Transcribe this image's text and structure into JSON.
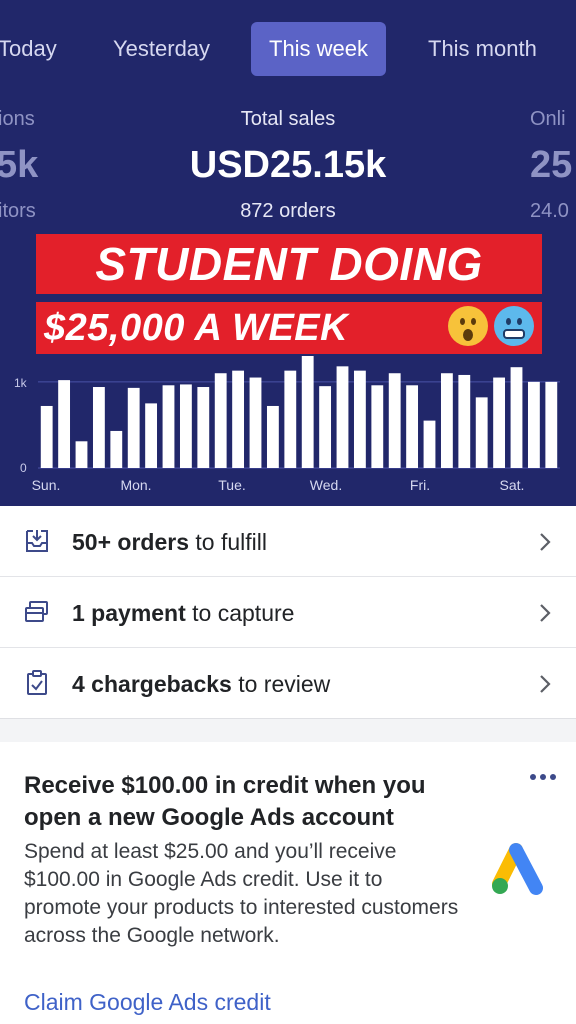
{
  "tabs": [
    {
      "label": "Today"
    },
    {
      "label": "Yesterday"
    },
    {
      "label": "This week",
      "active": true
    },
    {
      "label": "This month"
    }
  ],
  "stats": {
    "left": {
      "label": "ions",
      "value": "5k",
      "sub": "itors"
    },
    "center": {
      "label": "Total sales",
      "value": "USD25.15k",
      "sub": "872 orders"
    },
    "right": {
      "label": "Onli",
      "value": "25",
      "sub": "24.0"
    }
  },
  "overlay": {
    "line1": "STUDENT DOING",
    "line2": "$25,000 A WEEK",
    "emojis": [
      "astonished-face",
      "cold-face"
    ]
  },
  "chart_data": {
    "type": "bar",
    "ylabel_ticks": [
      "0",
      "1k"
    ],
    "ylim": [
      0,
      1300
    ],
    "grid": true,
    "day_labels": [
      "Sun.",
      "Mon.",
      "Tue.",
      "Wed.",
      "Fri.",
      "Sat."
    ],
    "values": [
      720,
      1020,
      310,
      940,
      430,
      930,
      750,
      960,
      970,
      940,
      1100,
      1130,
      1050,
      720,
      1130,
      1380,
      950,
      1180,
      1130,
      960,
      1100,
      960,
      550,
      1100,
      1080,
      820,
      1050,
      1170,
      1000,
      1000
    ]
  },
  "tasks": [
    {
      "bold": "50+ orders",
      "rest": " to fulfill",
      "icon": "inbox-download-icon"
    },
    {
      "bold": "1 payment",
      "rest": " to capture",
      "icon": "payment-card-icon"
    },
    {
      "bold": "4 chargebacks",
      "rest": " to review",
      "icon": "clipboard-check-icon"
    }
  ],
  "card": {
    "title": "Receive $100.00 in credit when you open a new Google Ads account",
    "body": "Spend at least $25.00 and you’ll receive $100.00 in Google Ads credit. Use it to promote your products to interested customers across the Google network.",
    "link": "Claim Google Ads credit"
  },
  "colors": {
    "header_bg": "#21276a",
    "active_tab": "#5b63c6",
    "banner_red": "#e3202a",
    "link_blue": "#3f62c8"
  }
}
